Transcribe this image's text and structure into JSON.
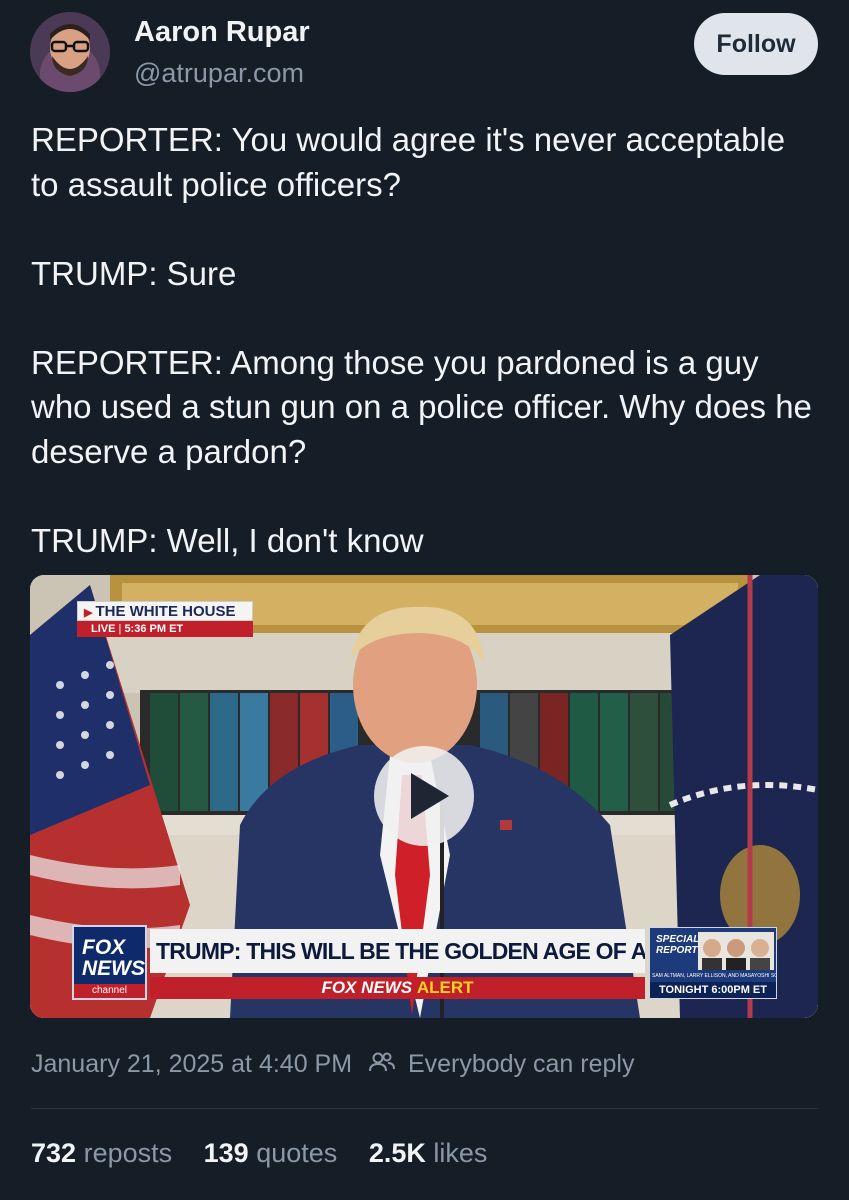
{
  "author": {
    "display_name": "Aaron Rupar",
    "handle": "@atrupar.com",
    "follow_label": "Follow"
  },
  "post": {
    "paragraphs": [
      "REPORTER: You would agree it's never acceptable to assault police officers?",
      "TRUMP: Sure",
      "REPORTER: Among those you pardoned is a guy who used a stun gun on a police officer. Why does he deserve a pardon?",
      "TRUMP: Well, I don't know"
    ]
  },
  "video": {
    "bug_title": "THE WHITE HOUSE",
    "bug_live": "LIVE",
    "bug_time": "5:36 PM ET",
    "logo_line1": "FOX",
    "logo_line2": "NEWS",
    "logo_line3": "channel",
    "chyron": "TRUMP: THIS WILL BE THE GOLDEN AGE OF AMERICA",
    "alert_prefix": "FOX NEWS",
    "alert_suffix": "ALERT",
    "special_title": "SPECIAL REPORT",
    "special_names": "SAM ALTMAN, LARRY ELLISON, AND MASAYOSHI SON",
    "special_time": "TONIGHT 6:00PM ET"
  },
  "meta": {
    "timestamp": "January 21, 2025 at 4:40 PM",
    "reply_setting": "Everybody can reply"
  },
  "stats": {
    "reposts_count": "732",
    "reposts_label": "reposts",
    "quotes_count": "139",
    "quotes_label": "quotes",
    "likes_count": "2.5K",
    "likes_label": "likes"
  },
  "colors": {
    "background": "#151d27",
    "muted_text": "#8b98a8",
    "follow_bg": "#dfe5ea"
  }
}
